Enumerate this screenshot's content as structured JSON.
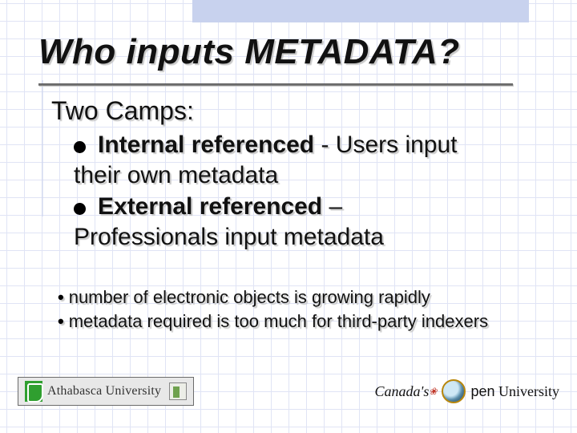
{
  "title": "Who inputs METADATA?",
  "subhead": "Two Camps:",
  "bullets": [
    {
      "bold": "Internal referenced",
      "sep": " - ",
      "rest1": "Users input",
      "rest2": "their own metadata"
    },
    {
      "bold": "External referenced",
      "sep": " – ",
      "rest1": "",
      "rest2": "Professionals input metadata"
    }
  ],
  "sub_bullets": [
    "number of electronic objects is growing rapidly",
    "metadata required is too much for third-party indexers"
  ],
  "footer": {
    "athabasca": "Athabasca University",
    "canada_left": "Canada's",
    "canada_right_pen": "pen",
    "canada_right_rest": " University"
  }
}
